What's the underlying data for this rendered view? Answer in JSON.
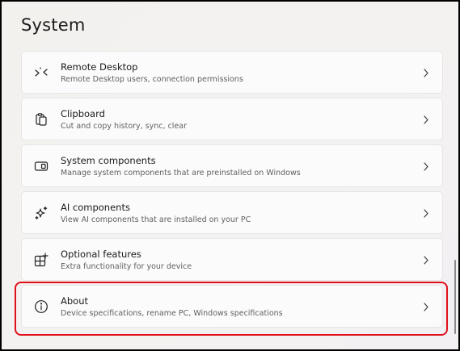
{
  "page": {
    "title": "System"
  },
  "items": [
    {
      "title": "Remote Desktop",
      "desc": "Remote Desktop users, connection permissions",
      "icon": "remote-desktop-icon"
    },
    {
      "title": "Clipboard",
      "desc": "Cut and copy history, sync, clear",
      "icon": "clipboard-icon"
    },
    {
      "title": "System components",
      "desc": "Manage system components that are preinstalled on Windows",
      "icon": "system-components-icon"
    },
    {
      "title": "AI components",
      "desc": "View AI components that are installed on your PC",
      "icon": "sparkle-icon"
    },
    {
      "title": "Optional features",
      "desc": "Extra functionality for your device",
      "icon": "optional-features-icon"
    },
    {
      "title": "About",
      "desc": "Device specifications, rename PC, Windows specifications",
      "icon": "info-icon"
    }
  ],
  "colors": {
    "highlight": "#e0101a",
    "text": "#1b1b1b",
    "subtext": "#606060",
    "card": "#fbfbfb"
  }
}
